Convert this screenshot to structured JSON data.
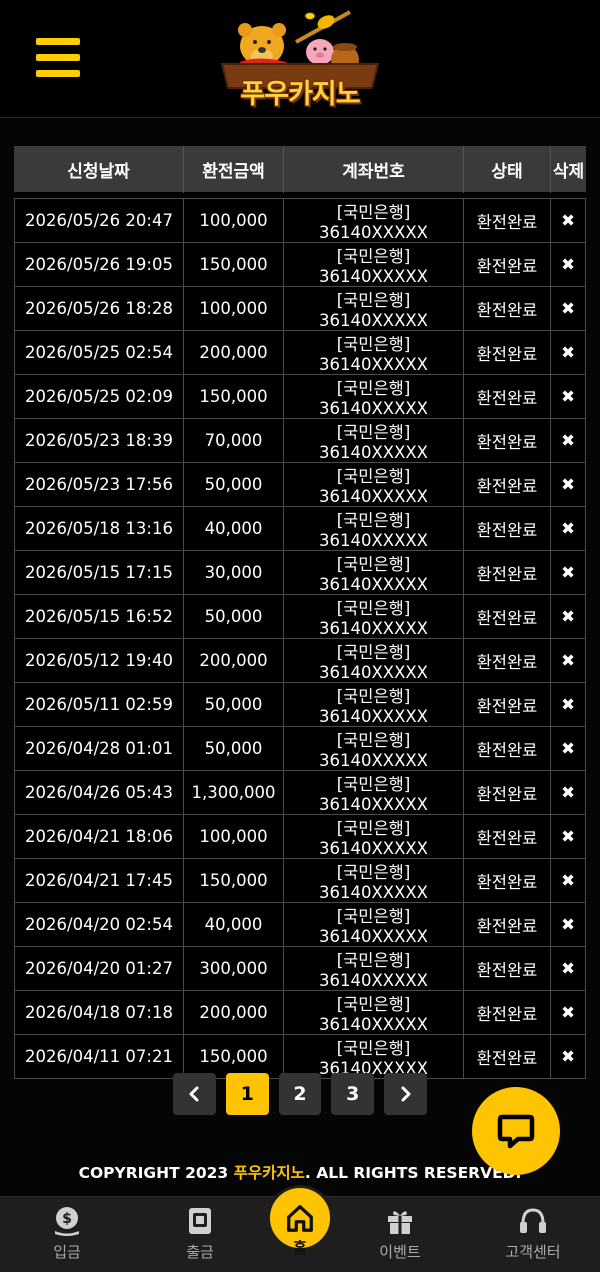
{
  "header": {
    "logo_text": "푸우카지노"
  },
  "table": {
    "columns": [
      "신청날짜",
      "환전금액",
      "계좌번호",
      "상태",
      "삭제"
    ],
    "rows": [
      {
        "date": "2026/05/26 20:47",
        "amount": "100,000",
        "account": "[국민은행] 36140XXXXX",
        "status": "환전완료"
      },
      {
        "date": "2026/05/26 19:05",
        "amount": "150,000",
        "account": "[국민은행] 36140XXXXX",
        "status": "환전완료"
      },
      {
        "date": "2026/05/26 18:28",
        "amount": "100,000",
        "account": "[국민은행] 36140XXXXX",
        "status": "환전완료"
      },
      {
        "date": "2026/05/25 02:54",
        "amount": "200,000",
        "account": "[국민은행] 36140XXXXX",
        "status": "환전완료"
      },
      {
        "date": "2026/05/25 02:09",
        "amount": "150,000",
        "account": "[국민은행] 36140XXXXX",
        "status": "환전완료"
      },
      {
        "date": "2026/05/23 18:39",
        "amount": "70,000",
        "account": "[국민은행] 36140XXXXX",
        "status": "환전완료"
      },
      {
        "date": "2026/05/23 17:56",
        "amount": "50,000",
        "account": "[국민은행] 36140XXXXX",
        "status": "환전완료"
      },
      {
        "date": "2026/05/18 13:16",
        "amount": "40,000",
        "account": "[국민은행] 36140XXXXX",
        "status": "환전완료"
      },
      {
        "date": "2026/05/15 17:15",
        "amount": "30,000",
        "account": "[국민은행] 36140XXXXX",
        "status": "환전완료"
      },
      {
        "date": "2026/05/15 16:52",
        "amount": "50,000",
        "account": "[국민은행] 36140XXXXX",
        "status": "환전완료"
      },
      {
        "date": "2026/05/12 19:40",
        "amount": "200,000",
        "account": "[국민은행] 36140XXXXX",
        "status": "환전완료"
      },
      {
        "date": "2026/05/11 02:59",
        "amount": "50,000",
        "account": "[국민은행] 36140XXXXX",
        "status": "환전완료"
      },
      {
        "date": "2026/04/28 01:01",
        "amount": "50,000",
        "account": "[국민은행] 36140XXXXX",
        "status": "환전완료"
      },
      {
        "date": "2026/04/26 05:43",
        "amount": "1,300,000",
        "account": "[국민은행] 36140XXXXX",
        "status": "환전완료"
      },
      {
        "date": "2026/04/21 18:06",
        "amount": "100,000",
        "account": "[국민은행] 36140XXXXX",
        "status": "환전완료"
      },
      {
        "date": "2026/04/21 17:45",
        "amount": "150,000",
        "account": "[국민은행] 36140XXXXX",
        "status": "환전완료"
      },
      {
        "date": "2026/04/20 02:54",
        "amount": "40,000",
        "account": "[국민은행] 36140XXXXX",
        "status": "환전완료"
      },
      {
        "date": "2026/04/20 01:27",
        "amount": "300,000",
        "account": "[국민은행] 36140XXXXX",
        "status": "환전완료"
      },
      {
        "date": "2026/04/18 07:18",
        "amount": "200,000",
        "account": "[국민은행] 36140XXXXX",
        "status": "환전완료"
      },
      {
        "date": "2026/04/11 07:21",
        "amount": "150,000",
        "account": "[국민은행] 36140XXXXX",
        "status": "환전완료"
      }
    ],
    "delete_glyph": "✖"
  },
  "pagination": {
    "pages": [
      "1",
      "2",
      "3"
    ],
    "current": "1",
    "prev_icon": "chevron-left-icon",
    "next_icon": "chevron-right-icon"
  },
  "footer": {
    "copyright_prefix": "COPYRIGHT 2023 ",
    "copyright_brand": "푸우카지노",
    "copyright_suffix": ". ALL RIGHTS RESERVED."
  },
  "bottom_nav": {
    "items": [
      {
        "label": "입금",
        "icon": "dollar-coin-icon"
      },
      {
        "label": "출금",
        "icon": "atm-withdraw-icon"
      },
      {
        "label": "홈",
        "icon": "home-icon"
      },
      {
        "label": "이벤트",
        "icon": "gift-icon"
      },
      {
        "label": "고객센터",
        "icon": "headset-icon"
      }
    ]
  },
  "colors": {
    "accent": "#ffc400",
    "background": "#050505",
    "header_row": "#3a3a3a",
    "account_link": "#5aa0ff"
  }
}
